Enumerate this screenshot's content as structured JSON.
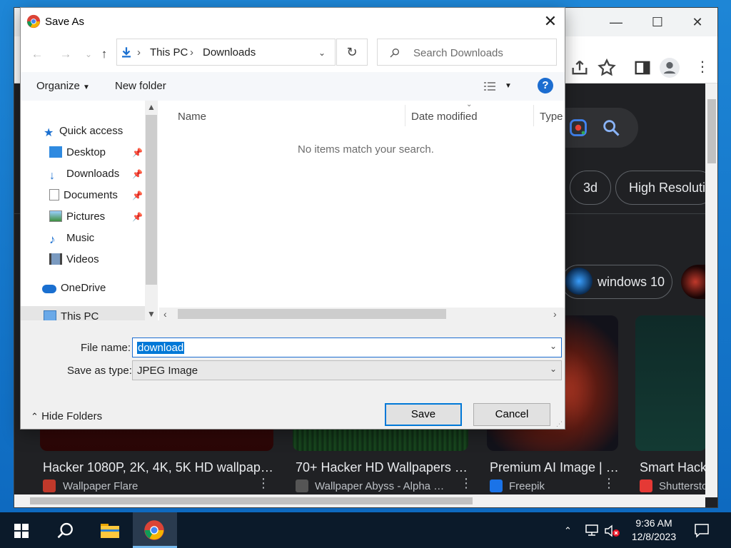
{
  "dialog": {
    "title": "Save As",
    "close_label": "✕",
    "address": {
      "crumbs": [
        "This PC",
        "Downloads"
      ]
    },
    "search_placeholder": "Search Downloads",
    "commands": {
      "organize": "Organize",
      "new_folder": "New folder",
      "help": "?"
    },
    "nav": {
      "quick_access": "Quick access",
      "items": [
        {
          "label": "Desktop",
          "pinned": true
        },
        {
          "label": "Downloads",
          "pinned": true
        },
        {
          "label": "Documents",
          "pinned": true
        },
        {
          "label": "Pictures",
          "pinned": true
        },
        {
          "label": "Music",
          "pinned": false
        },
        {
          "label": "Videos",
          "pinned": false
        }
      ],
      "onedrive": "OneDrive",
      "this_pc": "This PC"
    },
    "columns": [
      "Name",
      "Date modified",
      "Type"
    ],
    "empty_message": "No items match your search.",
    "file_name_label": "File name:",
    "file_name_value": "download",
    "save_type_label": "Save as type:",
    "save_type_value": "JPEG Image",
    "hide_folders": "Hide Folders",
    "save_button": "Save",
    "cancel_button": "Cancel"
  },
  "browser": {
    "chips": [
      "3d",
      "High Resolutio",
      "windows 10"
    ],
    "results": [
      {
        "title": "Hacker 1080P, 2K, 4K, 5K HD wallpap…",
        "source": "Wallpaper Flare"
      },
      {
        "title": "70+ Hacker HD Wallpapers …",
        "source": "Wallpaper Abyss - Alpha …"
      },
      {
        "title": "Premium AI Image | …",
        "source": "Freepik"
      },
      {
        "title": "Smart Hack",
        "source": "Shuttersto"
      }
    ],
    "colors": {
      "background": "#202124",
      "chip_border": "#5f6368"
    }
  },
  "taskbar": {
    "time": "9:36 AM",
    "date": "12/8/2023"
  },
  "colors": {
    "accent": "#0078d7",
    "help_blue": "#1c6dd0",
    "taskbar": "#0b1a2a"
  }
}
